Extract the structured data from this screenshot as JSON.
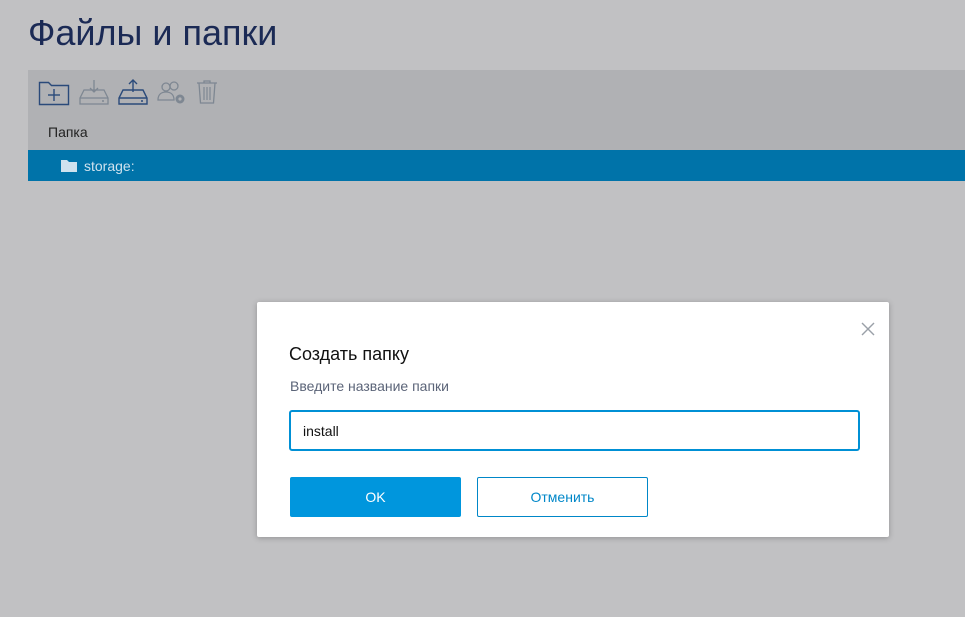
{
  "page": {
    "title": "Файлы и папки"
  },
  "toolbar": {
    "buttons": [
      {
        "icon": "new-folder-icon",
        "enabled": true
      },
      {
        "icon": "download-icon",
        "enabled": false
      },
      {
        "icon": "upload-icon",
        "enabled": true
      },
      {
        "icon": "user-settings-icon",
        "enabled": false
      },
      {
        "icon": "trash-icon",
        "enabled": false
      }
    ]
  },
  "table": {
    "column_header": "Папка",
    "rows": [
      {
        "label": "storage:",
        "selected": true
      }
    ]
  },
  "dialog": {
    "title": "Создать папку",
    "subtitle": "Введите название папки",
    "input_value": "install",
    "ok_label": "OK",
    "cancel_label": "Отменить"
  },
  "colors": {
    "accent": "#0096dd",
    "selection": "#0073a9",
    "title": "#1b2a55",
    "overlay_bg": "#c1c1c3"
  }
}
